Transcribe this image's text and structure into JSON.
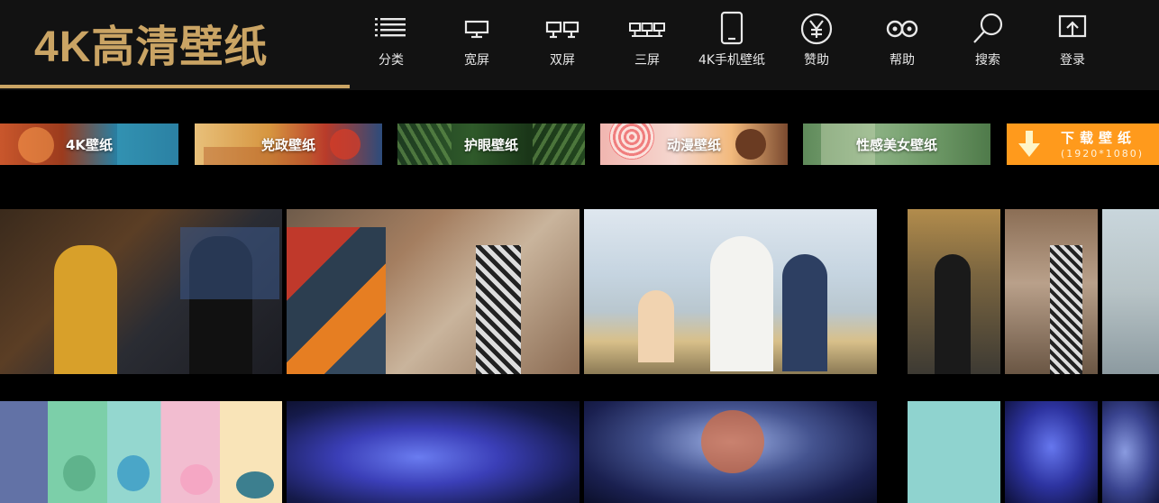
{
  "header": {
    "logo_text": "4K高清壁纸",
    "brand_color": "#caa464",
    "nav": [
      {
        "label": "分类",
        "icon": "list-icon"
      },
      {
        "label": "宽屏",
        "icon": "monitor-icon"
      },
      {
        "label": "双屏",
        "icon": "dual-monitor-icon"
      },
      {
        "label": "三屏",
        "icon": "triple-monitor-icon"
      },
      {
        "label": "4K手机壁纸",
        "icon": "phone-icon"
      },
      {
        "label": "赞助",
        "icon": "yen-icon"
      },
      {
        "label": "帮助",
        "icon": "help-icon"
      },
      {
        "label": "搜索",
        "icon": "search-icon"
      },
      {
        "label": "登录",
        "icon": "login-icon"
      }
    ]
  },
  "banners": [
    {
      "label": "4K壁纸"
    },
    {
      "label": "党政壁纸"
    },
    {
      "label": "护眼壁纸"
    },
    {
      "label": "动漫壁纸"
    },
    {
      "label": "性感美女壁纸"
    }
  ],
  "download": {
    "title": "下载壁纸",
    "subtitle": "(1920*1080)",
    "accent_color": "#ff9a1c"
  },
  "gallery": {
    "row1_count": 6,
    "row2_count": 6
  }
}
